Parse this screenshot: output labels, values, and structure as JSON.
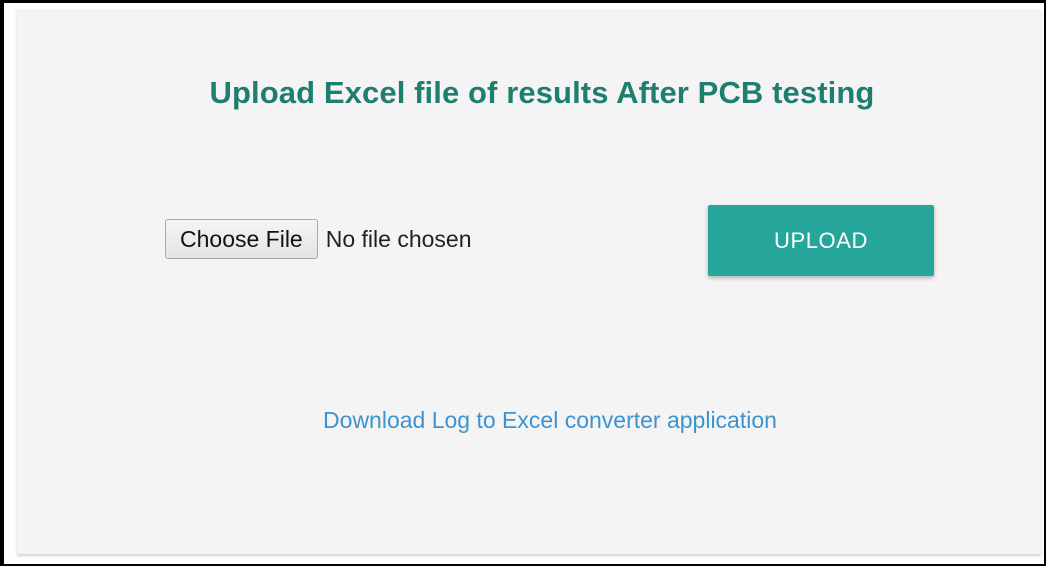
{
  "page": {
    "title": "Upload Excel file of results After PCB testing"
  },
  "file_input": {
    "button_label": "Choose File",
    "status": "No file chosen"
  },
  "upload": {
    "label": "UPLOAD"
  },
  "download": {
    "link_text": "Download Log to Excel converter application"
  },
  "colors": {
    "title": "#1e7f6f",
    "upload_button": "#26a69a",
    "link": "#3d93cf",
    "card_background": "#f4f4f4"
  }
}
